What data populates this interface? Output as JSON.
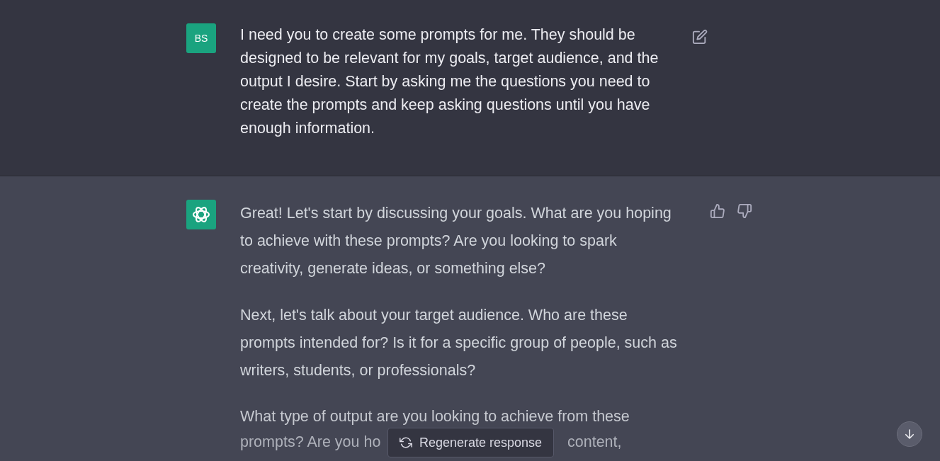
{
  "messages": [
    {
      "kind": "user",
      "avatar": "BS",
      "paragraphs": [
        {
          "kind": "text",
          "text": "I need you to create some prompts for me. They should be designed to be relevant for my goals, target audience, and the output I desire. Start by asking me the questions you need to create the prompts and keep asking questions until you have enough information."
        }
      ]
    },
    {
      "kind": "assistant",
      "paragraphs": [
        {
          "kind": "text",
          "text": "Great! Let's start by discussing your goals. What are you hoping to achieve with these prompts? Are you looking to spark creativity, generate ideas, or something else?"
        },
        {
          "kind": "text",
          "text": "Next, let's talk about your target audience. Who are these prompts intended for? Is it for a specific group of people, such as writers, students, or professionals?"
        },
        {
          "kind": "partial",
          "lines": [
            {
              "segments": [
                "What type of output are you looking to achieve from these"
              ]
            },
            {
              "segments": [
                "prompts? Are you ho",
                "content,"
              ]
            }
          ]
        }
      ]
    }
  ],
  "regenerate_button": {
    "label": "Regenerate response"
  }
}
